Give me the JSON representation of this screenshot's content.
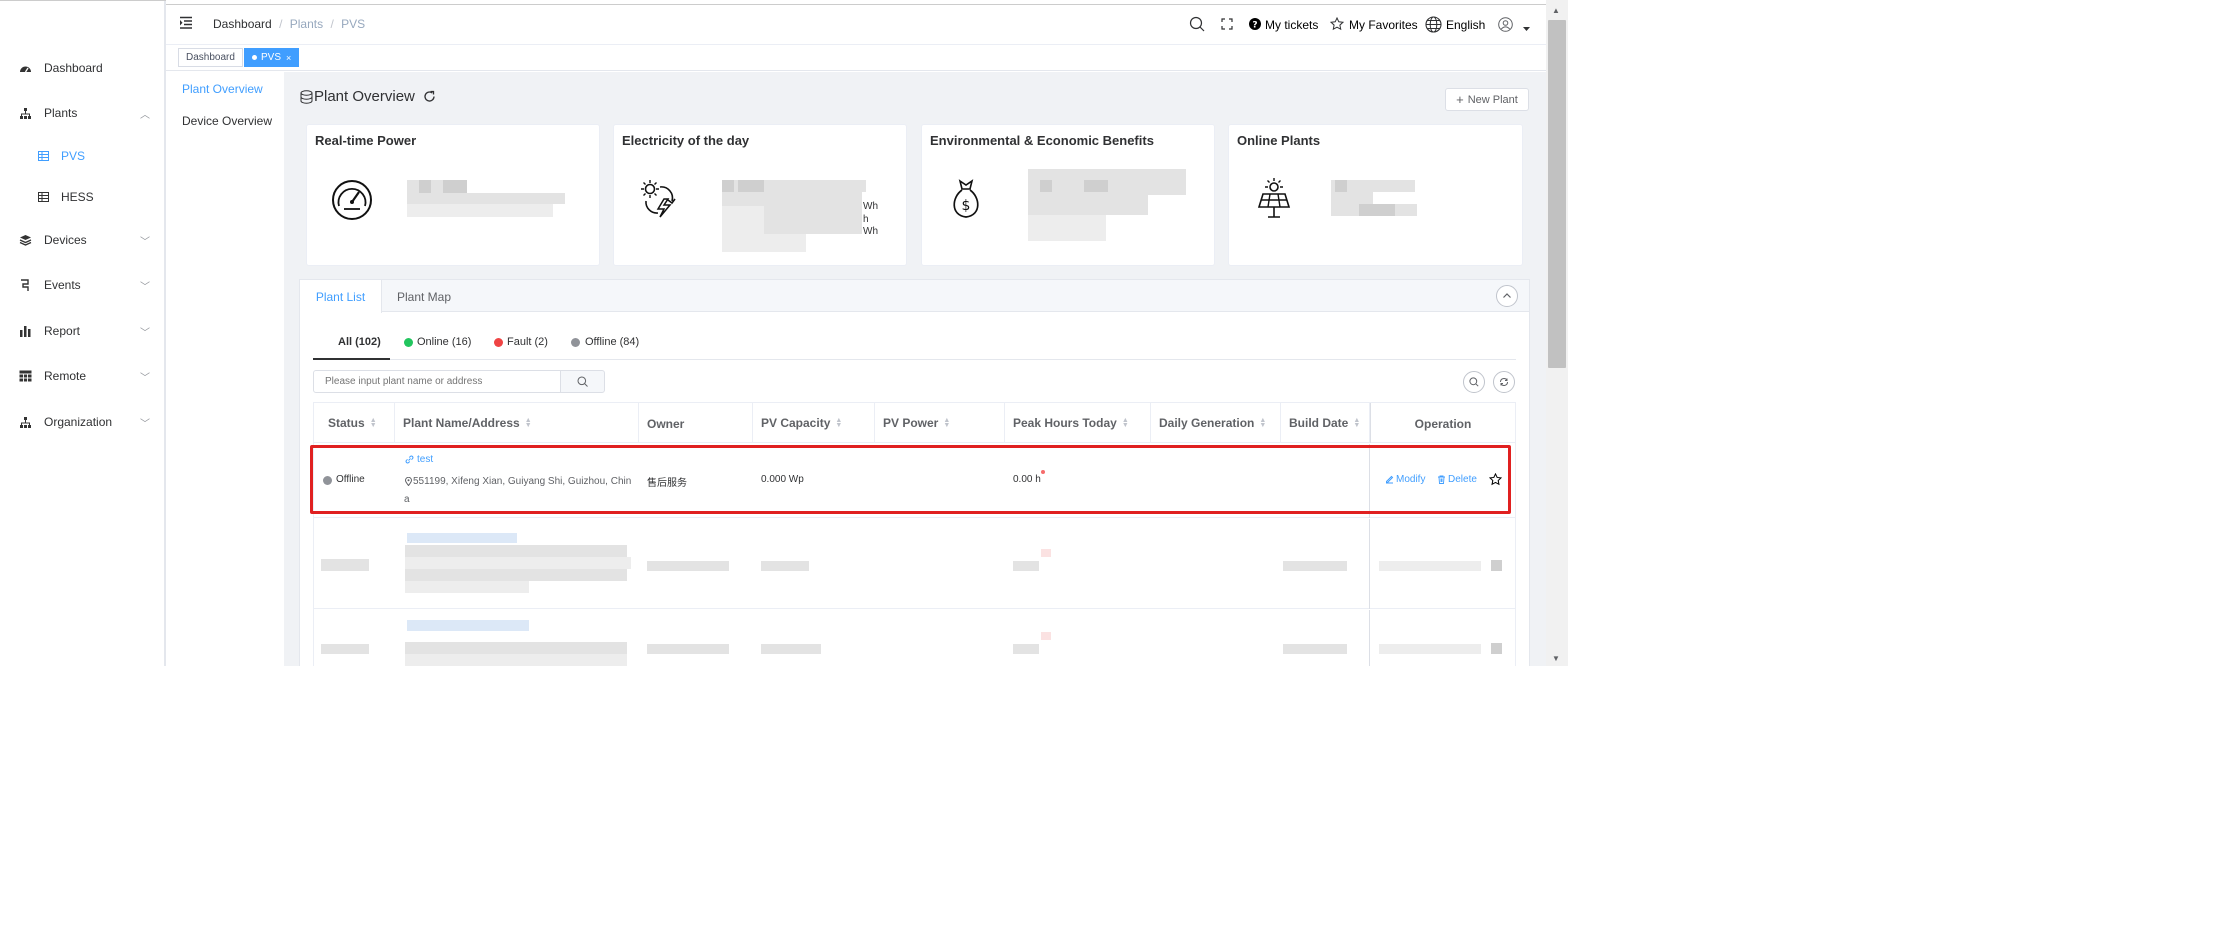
{
  "sidebar": {
    "items": [
      {
        "label": "Dashboard",
        "icon": "dashboard-icon"
      },
      {
        "label": "Plants",
        "icon": "sitemap-icon",
        "expanded": true
      },
      {
        "label": "PVS",
        "icon": "table-icon",
        "active": true
      },
      {
        "label": "HESS",
        "icon": "table-icon"
      },
      {
        "label": "Devices",
        "icon": "devices-icon"
      },
      {
        "label": "Events",
        "icon": "events-icon"
      },
      {
        "label": "Report",
        "icon": "report-icon"
      },
      {
        "label": "Remote",
        "icon": "remote-icon"
      },
      {
        "label": "Organization",
        "icon": "sitemap-icon"
      }
    ]
  },
  "header": {
    "breadcrumb": [
      "Dashboard",
      "Plants",
      "PVS"
    ],
    "sep": "/",
    "my_tickets": "My tickets",
    "my_favorites": "My Favorites",
    "language": "English"
  },
  "tags": [
    {
      "label": "Dashboard"
    },
    {
      "label": "PVS",
      "close": "×",
      "active": true
    }
  ],
  "subnav": {
    "items": [
      "Plant Overview",
      "Device Overview"
    ]
  },
  "page": {
    "title": "Plant Overview",
    "new_plant": "New Plant",
    "new_plant_prefix": "+"
  },
  "cards": [
    {
      "title": "Real-time Power",
      "icon": "gauge-icon"
    },
    {
      "title": "Electricity of the day",
      "icon": "sun-energy-icon",
      "units": [
        "Wh",
        "h",
        "Wh"
      ]
    },
    {
      "title": "Environmental & Economic Benefits",
      "icon": "money-bag-icon"
    },
    {
      "title": "Online Plants",
      "icon": "solar-panel-icon"
    }
  ],
  "panel_tabs": [
    "Plant List",
    "Plant Map"
  ],
  "filters": [
    {
      "label": "All (102)",
      "color": ""
    },
    {
      "label": "Online (16)",
      "color": "#22c55e"
    },
    {
      "label": "Fault (2)",
      "color": "#ef4444"
    },
    {
      "label": "Offline (84)",
      "color": "#909399"
    }
  ],
  "search": {
    "placeholder": "Please input plant name or address"
  },
  "table": {
    "headers": [
      "Status",
      "Plant Name/Address",
      "Owner",
      "PV Capacity",
      "PV Power",
      "Peak Hours Today",
      "Daily Generation",
      "Build Date",
      "Operation"
    ],
    "row": {
      "status": "Offline",
      "status_color": "#909399",
      "name": "test",
      "address_line1": "551199, Xifeng Xian, Guiyang Shi, Guizhou, Chin",
      "address_line2": "a",
      "owner": "售后服务",
      "pv_capacity": "0.000 Wp",
      "pv_power": "",
      "peak_hours": "0.00 h",
      "daily_generation": "",
      "build_date": "",
      "modify": "Modify",
      "delete": "Delete"
    }
  },
  "colors": {
    "accent": "#409eff",
    "highlight": "#e02020"
  }
}
